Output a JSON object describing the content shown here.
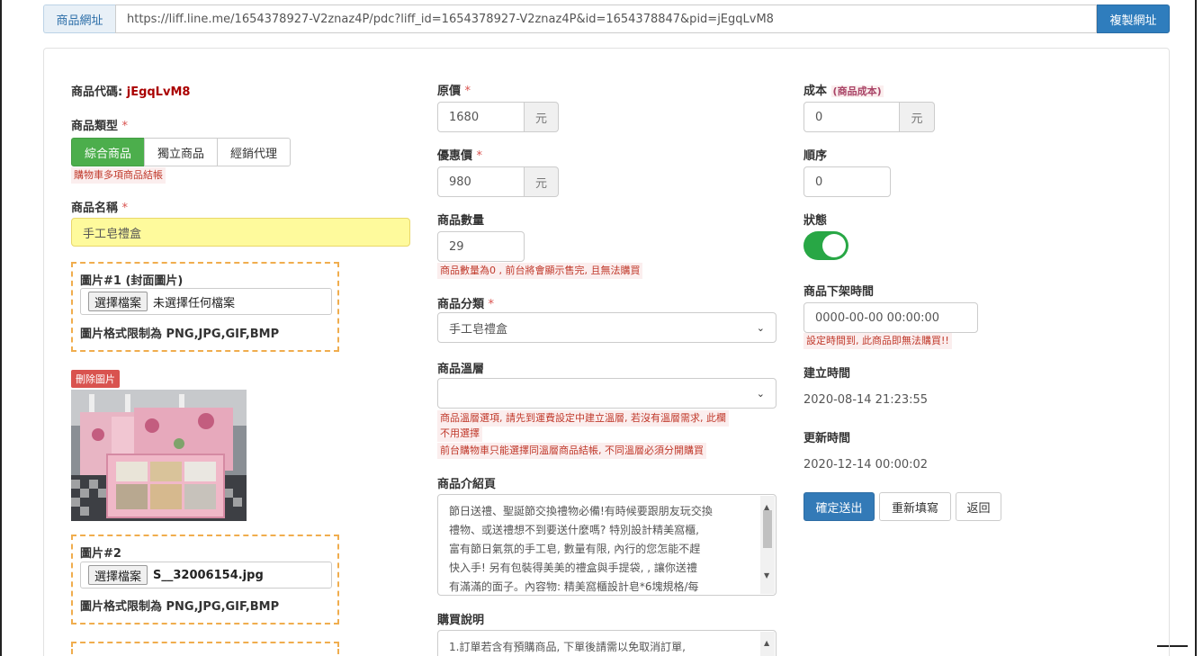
{
  "url_bar": {
    "label": "商品網址",
    "url": "https://liff.line.me/1654378927-V2znaz4P/pdc?liff_id=1654378927-V2znaz4P&id=1654378847&pid=jEgqLvM8",
    "copy_button": "複製網址"
  },
  "left": {
    "code_label": "商品代碼:",
    "code_value": "jEgqLvM8",
    "type_label": "商品類型",
    "required_mark": "*",
    "type_options": [
      "綜合商品",
      "獨立商品",
      "經銷代理"
    ],
    "type_selected": "綜合商品",
    "type_help": "購物車多項商品結帳",
    "name_label": "商品名稱",
    "name_value": "手工皂禮盒",
    "image1": {
      "label": "圖片#1 (封面圖片)",
      "button": "選擇檔案",
      "file": "未選擇任何檔案",
      "note": "圖片格式限制為 PNG,JPG,GIF,BMP"
    },
    "delete_image": "刪除圖片",
    "image2": {
      "label": "圖片#2",
      "button": "選擇檔案",
      "file": "S__32006154.jpg",
      "note": "圖片格式限制為 PNG,JPG,GIF,BMP"
    }
  },
  "middle": {
    "price_label": "原價",
    "price_value": "1680",
    "currency": "元",
    "sale_label": "優惠價",
    "sale_value": "980",
    "qty_label": "商品數量",
    "qty_value": "29",
    "qty_help": "商品數量為0 , 前台將會顯示售完, 且無法購買",
    "category_label": "商品分類",
    "category_value": "手工皂禮盒",
    "temp_label": "商品溫層",
    "temp_value": "",
    "temp_help1": "商品溫層選項, 請先到運費設定中建立溫層, 若沒有溫層需求, 此欄",
    "temp_help1b": "不用選擇",
    "temp_help2": "前台購物車只能選擇同溫層商品結帳, 不同溫層必須分開購買",
    "intro_label": "商品介紹頁",
    "intro_lines": [
      "節日送禮、聖誕節交換禮物必備!有時候要跟朋友玩交換",
      "禮物、或送禮想不到要送什麼嗎? 特別設計精美窩櫃,",
      "富有節日氣氛的手工皂, 數量有限, 內行的您怎能不趕",
      "快入手! 另有包裝得美美的禮盒與手提袋, , 讓你送禮",
      "有滿滿的面子。內容物: 精美窩櫃設計皂*6塊規格/每"
    ],
    "purchase_label": "購買說明",
    "purchase_line": "1.訂單若含有預購商品, 下單後請需以免取消訂單,"
  },
  "right": {
    "cost_label": "成本",
    "cost_hint": "(商品成本)",
    "cost_value": "0",
    "currency": "元",
    "order_label": "順序",
    "order_value": "0",
    "status_label": "狀態",
    "status_on": true,
    "offshelf_label": "商品下架時間",
    "offshelf_value": "0000-00-00 00:00:00",
    "offshelf_help": "設定時間到, 此商品即無法購買!!",
    "created_label": "建立時間",
    "created_value": "2020-08-14 21:23:55",
    "updated_label": "更新時間",
    "updated_value": "2020-12-14 00:00:02",
    "submit": "確定送出",
    "reset": "重新填寫",
    "back": "返回"
  }
}
